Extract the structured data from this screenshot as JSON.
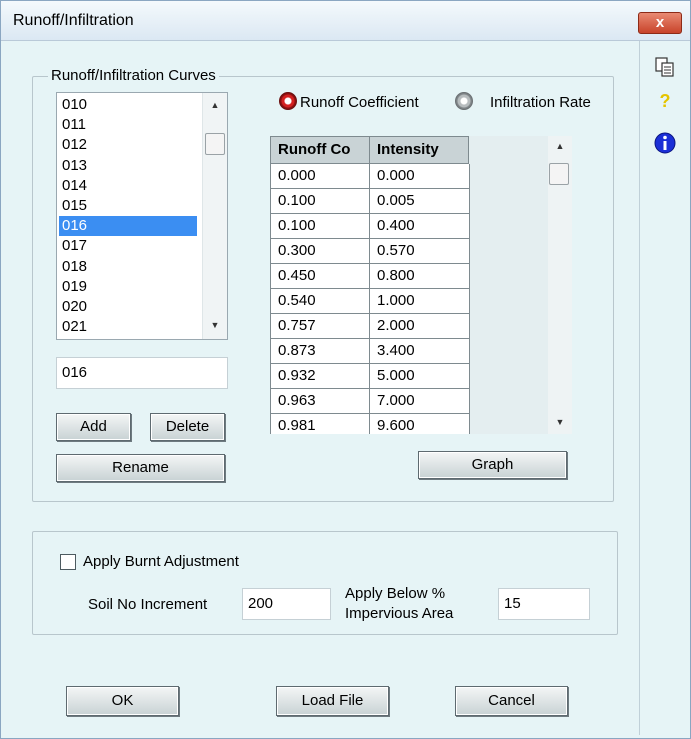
{
  "window": {
    "title": "Runoff/Infiltration",
    "close_label": "x"
  },
  "curves": {
    "legend": "Runoff/Infiltration Curves",
    "items": [
      "010",
      "011",
      "012",
      "013",
      "014",
      "015",
      "016",
      "017",
      "018",
      "019",
      "020",
      "021"
    ],
    "selected": "016",
    "name_value": "016",
    "add_label": "Add",
    "delete_label": "Delete",
    "rename_label": "Rename",
    "graph_label": "Graph"
  },
  "mode": {
    "runoff_label": "Runoff Coefficient",
    "infiltration_label": "Infiltration Rate",
    "selected": "Runoff Coefficient"
  },
  "table": {
    "headers": [
      "Runoff Co",
      "Intensity"
    ],
    "rows": [
      [
        "0.000",
        "0.000"
      ],
      [
        "0.100",
        "0.005"
      ],
      [
        "0.100",
        "0.400"
      ],
      [
        "0.300",
        "0.570"
      ],
      [
        "0.450",
        "0.800"
      ],
      [
        "0.540",
        "1.000"
      ],
      [
        "0.757",
        "2.000"
      ],
      [
        "0.873",
        "3.400"
      ],
      [
        "0.932",
        "5.000"
      ],
      [
        "0.963",
        "7.000"
      ],
      [
        "0.981",
        "9.600"
      ]
    ]
  },
  "burnt": {
    "checkbox_label": "Apply Burnt Adjustment",
    "checked": false,
    "soil_label": "Soil No Increment",
    "soil_value": "200",
    "apply_below_label_line1": "Apply Below %",
    "apply_below_label_line2": "Impervious Area",
    "apply_below_value": "15"
  },
  "footer": {
    "ok_label": "OK",
    "load_label": "Load File",
    "cancel_label": "Cancel"
  },
  "side_icons": [
    "copy-icon",
    "help-icon",
    "info-icon"
  ],
  "colors": {
    "selection": "#3b8ef2",
    "radio_on": "#d42020",
    "background": "#e6f4f6"
  }
}
